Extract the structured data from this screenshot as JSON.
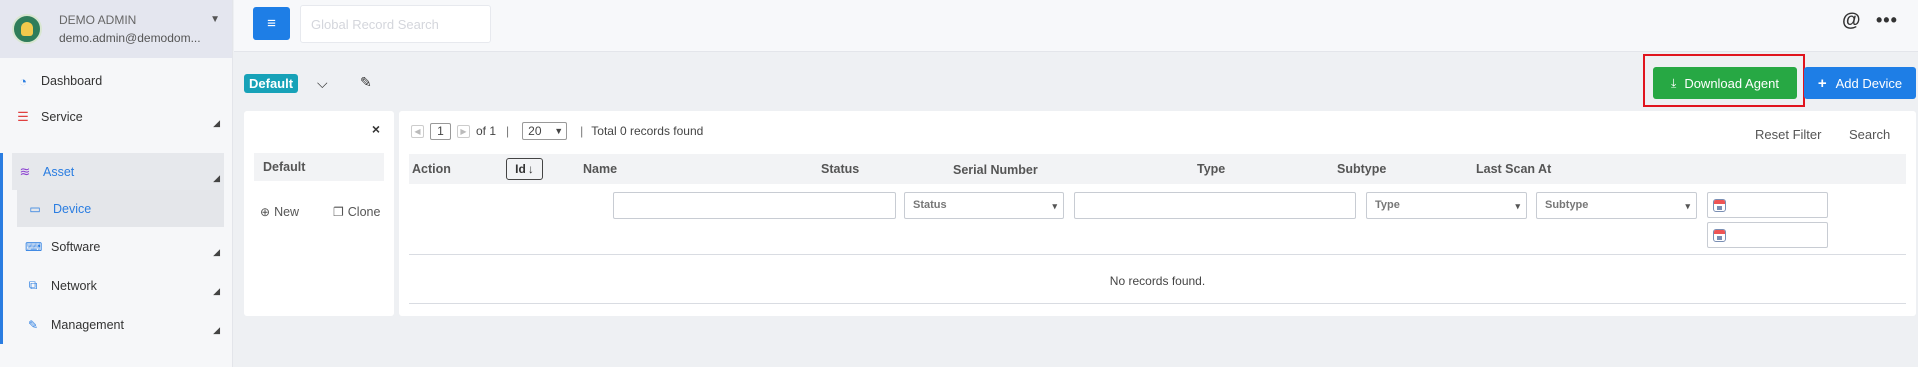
{
  "user": {
    "name": "DEMO ADMIN",
    "email": "demo.admin@demodom..."
  },
  "sidebar": {
    "items": [
      {
        "label": "Dashboard",
        "icon": "speedometer-icon"
      },
      {
        "label": "Service",
        "icon": "list-icon"
      }
    ],
    "asset": {
      "label": "Asset",
      "icon": "wifi-icon"
    },
    "asset_children": [
      {
        "label": "Device",
        "icon": "monitor-icon"
      },
      {
        "label": "Software",
        "icon": "keyboard-icon"
      },
      {
        "label": "Network",
        "icon": "network-icon"
      },
      {
        "label": "Management",
        "icon": "wrench-icon"
      }
    ]
  },
  "header": {
    "search_placeholder": "Global Record Search",
    "at_symbol": "@",
    "more_symbol": "•••"
  },
  "toolbar": {
    "view_name": "Default",
    "download_label": "Download Agent",
    "add_label": "Add Device"
  },
  "filter_panel": {
    "close": "×",
    "default_filter": "Default",
    "new_label": "New",
    "clone_label": "Clone"
  },
  "grid": {
    "page": "1",
    "of_label": "of 1",
    "separator": "|",
    "page_size": "20",
    "total_label": "Total 0 records found",
    "reset_filter": "Reset Filter",
    "search": "Search",
    "columns": {
      "action": "Action",
      "id": "Id",
      "name": "Name",
      "status": "Status",
      "serial": "Serial Number",
      "type": "Type",
      "subtype": "Subtype",
      "last_scan": "Last Scan At"
    },
    "filters": {
      "status_placeholder": "Status",
      "type_placeholder": "Type",
      "subtype_placeholder": "Subtype"
    },
    "empty_message": "No records found."
  },
  "colors": {
    "primary": "#1e7ee6",
    "success": "#27a844",
    "info_badge": "#17a2b8",
    "highlight": "#e0141e"
  }
}
